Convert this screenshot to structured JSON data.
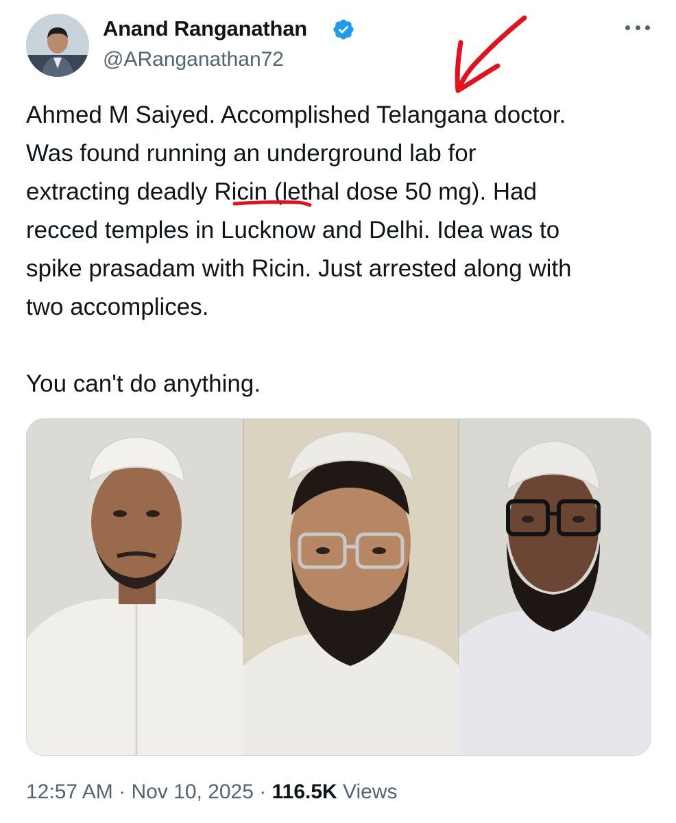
{
  "author": {
    "name": "Anand Ranganathan",
    "handle": "@ARanganathan72",
    "verified": true,
    "verified_color": "#1d9bf0"
  },
  "menu": {
    "icon": "more-horizontal-icon"
  },
  "tweet": {
    "line_1": "Ahmed M Saiyed. Accomplished Telangana doctor.",
    "line_2": "Was found running an underground lab for",
    "line_3_before": "extracting deadly ",
    "line_3_highlight": "Ricin",
    "line_3_after": " (lethal dose 50 mg). Had",
    "line_4": "recced temples in Lucknow and Delhi. Idea was to",
    "line_5": "spike prasadam with Ricin. Just arrested along with",
    "line_6": "two accomplices.",
    "line_7": "You can't do anything."
  },
  "annotations": {
    "color": "#e3101e",
    "arrow": "hand-drawn-arrow-icon",
    "underline": "hand-drawn-underline"
  },
  "meta": {
    "time": "12:57 AM",
    "separator": "·",
    "date": "Nov 10, 2025",
    "views_count": "116.5K",
    "views_label": "Views"
  }
}
